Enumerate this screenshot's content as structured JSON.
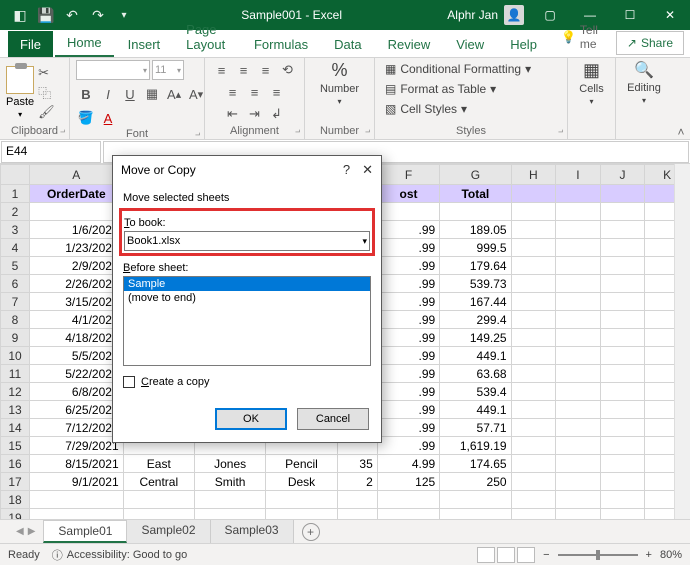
{
  "title": "Sample001 - Excel",
  "user_name": "Alphr Jan",
  "tabs": {
    "file": "File",
    "home": "Home",
    "insert": "Insert",
    "page_layout": "Page Layout",
    "formulas": "Formulas",
    "data": "Data",
    "review": "Review",
    "view": "View",
    "help": "Help",
    "tell_me": "Tell me",
    "share": "Share"
  },
  "ribbon": {
    "clipboard": "Clipboard",
    "paste": "Paste",
    "font": "Font",
    "alignment": "Alignment",
    "number": "Number",
    "cond_fmt": "Conditional Formatting",
    "fmt_table": "Format as Table",
    "cell_styles": "Cell Styles",
    "styles": "Styles",
    "cells": "Cells",
    "editing": "Editing"
  },
  "name_box": "E44",
  "columns": [
    "A",
    "B",
    "C",
    "D",
    "E",
    "F",
    "G",
    "H",
    "I",
    "J",
    "K"
  ],
  "header": {
    "A": "OrderDate",
    "F": "ost",
    "G": "Total"
  },
  "rows": [
    {
      "n": 3,
      "A": "1/6/2021",
      "F": ".99",
      "G": "189.05"
    },
    {
      "n": 4,
      "A": "1/23/2021",
      "F": ".99",
      "G": "999.5"
    },
    {
      "n": 5,
      "A": "2/9/2021",
      "F": ".99",
      "G": "179.64"
    },
    {
      "n": 6,
      "A": "2/26/2021",
      "F": ".99",
      "G": "539.73"
    },
    {
      "n": 7,
      "A": "3/15/2021",
      "F": ".99",
      "G": "167.44"
    },
    {
      "n": 8,
      "A": "4/1/2021",
      "F": ".99",
      "G": "299.4"
    },
    {
      "n": 9,
      "A": "4/18/2021",
      "F": ".99",
      "G": "149.25"
    },
    {
      "n": 10,
      "A": "5/5/2021",
      "F": ".99",
      "G": "449.1"
    },
    {
      "n": 11,
      "A": "5/22/2021",
      "F": ".99",
      "G": "63.68"
    },
    {
      "n": 12,
      "A": "6/8/2021",
      "F": ".99",
      "G": "539.4"
    },
    {
      "n": 13,
      "A": "6/25/2021",
      "F": ".99",
      "G": "449.1"
    },
    {
      "n": 14,
      "A": "7/12/2021",
      "F": ".99",
      "G": "57.71"
    },
    {
      "n": 15,
      "A": "7/29/2021",
      "F": ".99",
      "G": "1,619.19"
    },
    {
      "n": 16,
      "A": "8/15/2021",
      "B": "East",
      "C": "Jones",
      "D": "Pencil",
      "E": "35",
      "F": "4.99",
      "G": "174.65"
    },
    {
      "n": 17,
      "A": "9/1/2021",
      "B": "Central",
      "C": "Smith",
      "D": "Desk",
      "E": "2",
      "F": "125",
      "G": "250"
    }
  ],
  "sheet_tabs": [
    "Sample01",
    "Sample02",
    "Sample03"
  ],
  "status": {
    "ready": "Ready",
    "access": "Accessibility: Good to go",
    "zoom": "80%"
  },
  "dialog": {
    "title": "Move or Copy",
    "subtitle": "Move selected sheets",
    "to_book_label": "To book:",
    "to_book_value": "Book1.xlsx",
    "before_label": "Before sheet:",
    "list": [
      "Sample",
      "(move to end)"
    ],
    "create_copy": "Create a copy",
    "ok": "OK",
    "cancel": "Cancel"
  }
}
